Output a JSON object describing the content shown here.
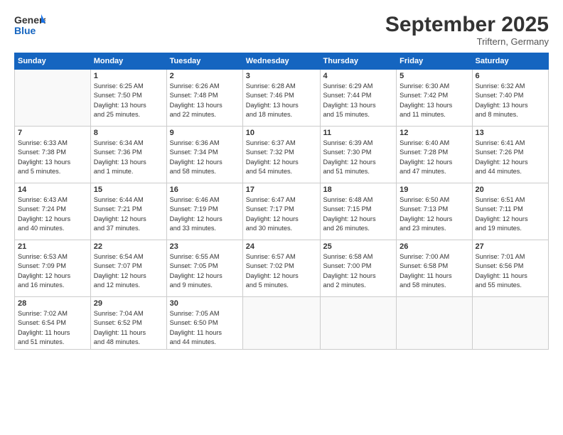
{
  "header": {
    "logo_general": "General",
    "logo_blue": "Blue",
    "month": "September 2025",
    "location": "Triftern, Germany"
  },
  "days_of_week": [
    "Sunday",
    "Monday",
    "Tuesday",
    "Wednesday",
    "Thursday",
    "Friday",
    "Saturday"
  ],
  "weeks": [
    [
      {
        "day": "",
        "info": ""
      },
      {
        "day": "1",
        "info": "Sunrise: 6:25 AM\nSunset: 7:50 PM\nDaylight: 13 hours\nand 25 minutes."
      },
      {
        "day": "2",
        "info": "Sunrise: 6:26 AM\nSunset: 7:48 PM\nDaylight: 13 hours\nand 22 minutes."
      },
      {
        "day": "3",
        "info": "Sunrise: 6:28 AM\nSunset: 7:46 PM\nDaylight: 13 hours\nand 18 minutes."
      },
      {
        "day": "4",
        "info": "Sunrise: 6:29 AM\nSunset: 7:44 PM\nDaylight: 13 hours\nand 15 minutes."
      },
      {
        "day": "5",
        "info": "Sunrise: 6:30 AM\nSunset: 7:42 PM\nDaylight: 13 hours\nand 11 minutes."
      },
      {
        "day": "6",
        "info": "Sunrise: 6:32 AM\nSunset: 7:40 PM\nDaylight: 13 hours\nand 8 minutes."
      }
    ],
    [
      {
        "day": "7",
        "info": "Sunrise: 6:33 AM\nSunset: 7:38 PM\nDaylight: 13 hours\nand 5 minutes."
      },
      {
        "day": "8",
        "info": "Sunrise: 6:34 AM\nSunset: 7:36 PM\nDaylight: 13 hours\nand 1 minute."
      },
      {
        "day": "9",
        "info": "Sunrise: 6:36 AM\nSunset: 7:34 PM\nDaylight: 12 hours\nand 58 minutes."
      },
      {
        "day": "10",
        "info": "Sunrise: 6:37 AM\nSunset: 7:32 PM\nDaylight: 12 hours\nand 54 minutes."
      },
      {
        "day": "11",
        "info": "Sunrise: 6:39 AM\nSunset: 7:30 PM\nDaylight: 12 hours\nand 51 minutes."
      },
      {
        "day": "12",
        "info": "Sunrise: 6:40 AM\nSunset: 7:28 PM\nDaylight: 12 hours\nand 47 minutes."
      },
      {
        "day": "13",
        "info": "Sunrise: 6:41 AM\nSunset: 7:26 PM\nDaylight: 12 hours\nand 44 minutes."
      }
    ],
    [
      {
        "day": "14",
        "info": "Sunrise: 6:43 AM\nSunset: 7:24 PM\nDaylight: 12 hours\nand 40 minutes."
      },
      {
        "day": "15",
        "info": "Sunrise: 6:44 AM\nSunset: 7:21 PM\nDaylight: 12 hours\nand 37 minutes."
      },
      {
        "day": "16",
        "info": "Sunrise: 6:46 AM\nSunset: 7:19 PM\nDaylight: 12 hours\nand 33 minutes."
      },
      {
        "day": "17",
        "info": "Sunrise: 6:47 AM\nSunset: 7:17 PM\nDaylight: 12 hours\nand 30 minutes."
      },
      {
        "day": "18",
        "info": "Sunrise: 6:48 AM\nSunset: 7:15 PM\nDaylight: 12 hours\nand 26 minutes."
      },
      {
        "day": "19",
        "info": "Sunrise: 6:50 AM\nSunset: 7:13 PM\nDaylight: 12 hours\nand 23 minutes."
      },
      {
        "day": "20",
        "info": "Sunrise: 6:51 AM\nSunset: 7:11 PM\nDaylight: 12 hours\nand 19 minutes."
      }
    ],
    [
      {
        "day": "21",
        "info": "Sunrise: 6:53 AM\nSunset: 7:09 PM\nDaylight: 12 hours\nand 16 minutes."
      },
      {
        "day": "22",
        "info": "Sunrise: 6:54 AM\nSunset: 7:07 PM\nDaylight: 12 hours\nand 12 minutes."
      },
      {
        "day": "23",
        "info": "Sunrise: 6:55 AM\nSunset: 7:05 PM\nDaylight: 12 hours\nand 9 minutes."
      },
      {
        "day": "24",
        "info": "Sunrise: 6:57 AM\nSunset: 7:02 PM\nDaylight: 12 hours\nand 5 minutes."
      },
      {
        "day": "25",
        "info": "Sunrise: 6:58 AM\nSunset: 7:00 PM\nDaylight: 12 hours\nand 2 minutes."
      },
      {
        "day": "26",
        "info": "Sunrise: 7:00 AM\nSunset: 6:58 PM\nDaylight: 11 hours\nand 58 minutes."
      },
      {
        "day": "27",
        "info": "Sunrise: 7:01 AM\nSunset: 6:56 PM\nDaylight: 11 hours\nand 55 minutes."
      }
    ],
    [
      {
        "day": "28",
        "info": "Sunrise: 7:02 AM\nSunset: 6:54 PM\nDaylight: 11 hours\nand 51 minutes."
      },
      {
        "day": "29",
        "info": "Sunrise: 7:04 AM\nSunset: 6:52 PM\nDaylight: 11 hours\nand 48 minutes."
      },
      {
        "day": "30",
        "info": "Sunrise: 7:05 AM\nSunset: 6:50 PM\nDaylight: 11 hours\nand 44 minutes."
      },
      {
        "day": "",
        "info": ""
      },
      {
        "day": "",
        "info": ""
      },
      {
        "day": "",
        "info": ""
      },
      {
        "day": "",
        "info": ""
      }
    ]
  ]
}
